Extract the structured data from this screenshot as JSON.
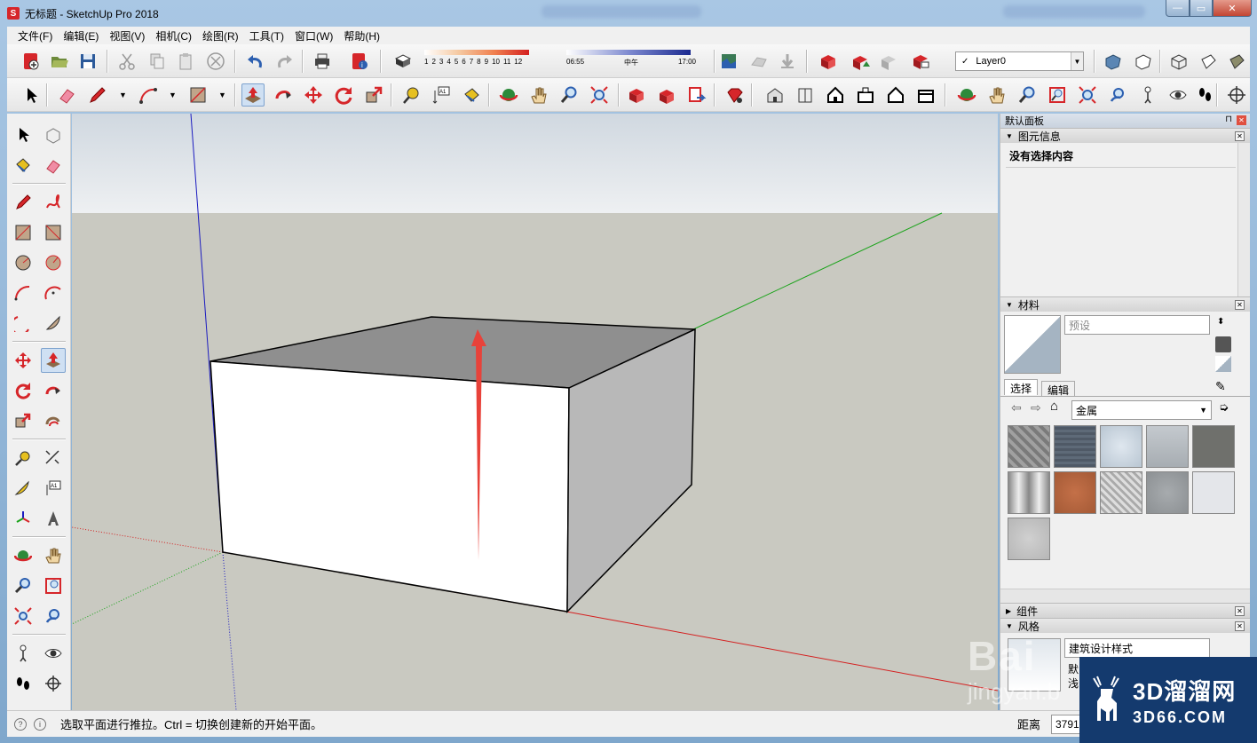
{
  "window": {
    "title": "无标题 - SketchUp Pro 2018",
    "app_icon_letter": "S",
    "controls": {
      "minimize": "—",
      "maximize": "▭",
      "close": "✕"
    }
  },
  "menu": [
    "文件(F)",
    "编辑(E)",
    "视图(V)",
    "相机(C)",
    "绘图(R)",
    "工具(T)",
    "窗口(W)",
    "帮助(H)"
  ],
  "shadow_settings": {
    "months": [
      "1",
      "2",
      "3",
      "4",
      "5",
      "6",
      "7",
      "8",
      "9",
      "10",
      "11",
      "12"
    ],
    "time_start": "06:55",
    "time_mid": "中午",
    "time_end": "17:00"
  },
  "layer": {
    "check": "✓",
    "current": "Layer0"
  },
  "default_tray": {
    "title": "默认面板",
    "pin": "⊓",
    "close": "✕"
  },
  "entity_info": {
    "title": "图元信息",
    "content": "没有选择内容"
  },
  "materials": {
    "title": "材料",
    "name_placeholder": "预设",
    "tab_select": "选择",
    "tab_edit": "编辑",
    "library": "金属",
    "swatches": [
      "#8e8e8e",
      "#56606e",
      "#c7d3de",
      "#b5babf",
      "#6f706c",
      "#bdbdbd",
      "#b4633f",
      "#c8c8c8",
      "#979b9e",
      "#e4e6ea",
      "#c4c4c4"
    ]
  },
  "components": {
    "title": "组件"
  },
  "styles": {
    "title": "风格",
    "style_name": "建筑设计样式",
    "desc_1": "默",
    "desc_2": "浅"
  },
  "status": {
    "message": "选取平面进行推拉。Ctrl = 切换创建新的开始平面。",
    "distance_label": "距离",
    "distance_value": "3791"
  },
  "watermark": {
    "site_cn": "3D溜溜网",
    "site_en": "3D66.COM",
    "baidu": "Bai",
    "jingyan": "jingyan.b"
  },
  "colors": {
    "sky_top": "#d0d8e0",
    "ground": "#c9c9c1",
    "axis_red": "#d42020",
    "axis_green": "#1aa31a",
    "axis_blue": "#1b1bc0",
    "push_arrow": "#e8423a"
  }
}
